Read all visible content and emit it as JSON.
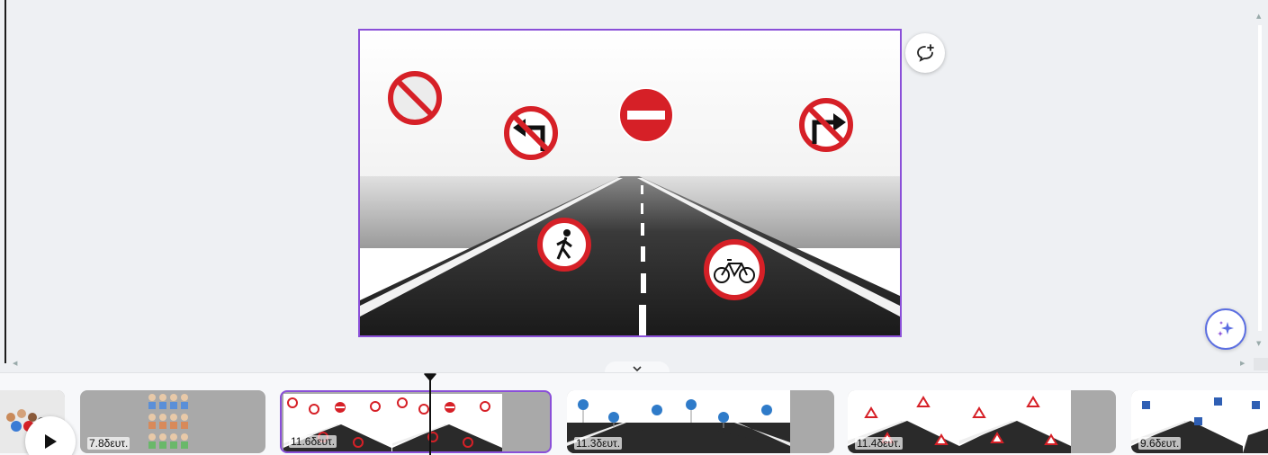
{
  "canvas": {
    "slide_label": "Road signs on highway slide",
    "icons": {
      "comment": "comment-add-icon",
      "magic": "sparkle-icon"
    }
  },
  "timeline": {
    "clips": [
      {
        "duration": ""
      },
      {
        "duration": "7.8δευτ."
      },
      {
        "duration": "11.6δευτ."
      },
      {
        "duration": "11.3δευτ."
      },
      {
        "duration": "11.4δευτ."
      },
      {
        "duration": "9.6δευτ."
      }
    ],
    "selected_index": 2
  },
  "colors": {
    "accent": "#8a4fd8",
    "sign_red": "#d62027",
    "magic": "#5b6ee1"
  }
}
